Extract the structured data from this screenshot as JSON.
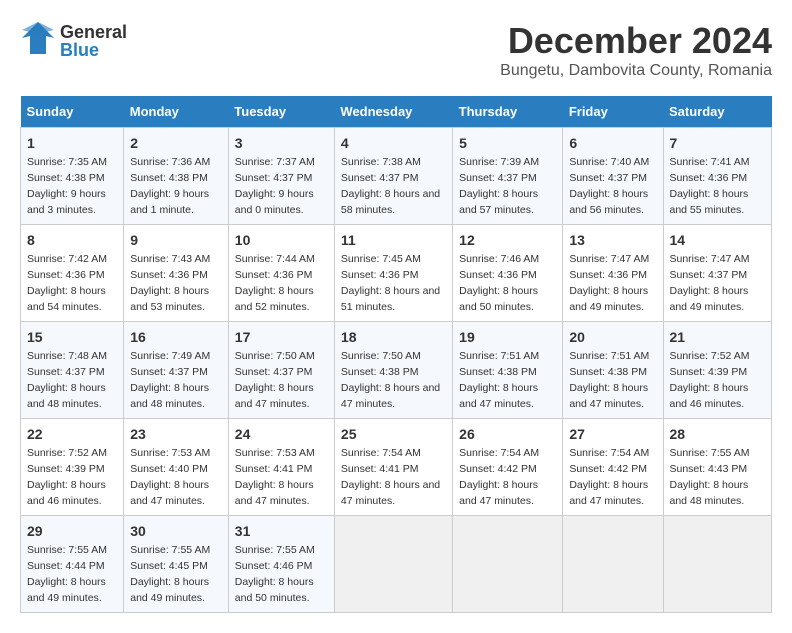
{
  "header": {
    "logo_general": "General",
    "logo_blue": "Blue",
    "month_title": "December 2024",
    "location": "Bungetu, Dambovita County, Romania"
  },
  "calendar": {
    "days_of_week": [
      "Sunday",
      "Monday",
      "Tuesday",
      "Wednesday",
      "Thursday",
      "Friday",
      "Saturday"
    ],
    "weeks": [
      [
        {
          "day": "1",
          "sunrise": "Sunrise: 7:35 AM",
          "sunset": "Sunset: 4:38 PM",
          "daylight": "Daylight: 9 hours and 3 minutes."
        },
        {
          "day": "2",
          "sunrise": "Sunrise: 7:36 AM",
          "sunset": "Sunset: 4:38 PM",
          "daylight": "Daylight: 9 hours and 1 minute."
        },
        {
          "day": "3",
          "sunrise": "Sunrise: 7:37 AM",
          "sunset": "Sunset: 4:37 PM",
          "daylight": "Daylight: 9 hours and 0 minutes."
        },
        {
          "day": "4",
          "sunrise": "Sunrise: 7:38 AM",
          "sunset": "Sunset: 4:37 PM",
          "daylight": "Daylight: 8 hours and 58 minutes."
        },
        {
          "day": "5",
          "sunrise": "Sunrise: 7:39 AM",
          "sunset": "Sunset: 4:37 PM",
          "daylight": "Daylight: 8 hours and 57 minutes."
        },
        {
          "day": "6",
          "sunrise": "Sunrise: 7:40 AM",
          "sunset": "Sunset: 4:37 PM",
          "daylight": "Daylight: 8 hours and 56 minutes."
        },
        {
          "day": "7",
          "sunrise": "Sunrise: 7:41 AM",
          "sunset": "Sunset: 4:36 PM",
          "daylight": "Daylight: 8 hours and 55 minutes."
        }
      ],
      [
        {
          "day": "8",
          "sunrise": "Sunrise: 7:42 AM",
          "sunset": "Sunset: 4:36 PM",
          "daylight": "Daylight: 8 hours and 54 minutes."
        },
        {
          "day": "9",
          "sunrise": "Sunrise: 7:43 AM",
          "sunset": "Sunset: 4:36 PM",
          "daylight": "Daylight: 8 hours and 53 minutes."
        },
        {
          "day": "10",
          "sunrise": "Sunrise: 7:44 AM",
          "sunset": "Sunset: 4:36 PM",
          "daylight": "Daylight: 8 hours and 52 minutes."
        },
        {
          "day": "11",
          "sunrise": "Sunrise: 7:45 AM",
          "sunset": "Sunset: 4:36 PM",
          "daylight": "Daylight: 8 hours and 51 minutes."
        },
        {
          "day": "12",
          "sunrise": "Sunrise: 7:46 AM",
          "sunset": "Sunset: 4:36 PM",
          "daylight": "Daylight: 8 hours and 50 minutes."
        },
        {
          "day": "13",
          "sunrise": "Sunrise: 7:47 AM",
          "sunset": "Sunset: 4:36 PM",
          "daylight": "Daylight: 8 hours and 49 minutes."
        },
        {
          "day": "14",
          "sunrise": "Sunrise: 7:47 AM",
          "sunset": "Sunset: 4:37 PM",
          "daylight": "Daylight: 8 hours and 49 minutes."
        }
      ],
      [
        {
          "day": "15",
          "sunrise": "Sunrise: 7:48 AM",
          "sunset": "Sunset: 4:37 PM",
          "daylight": "Daylight: 8 hours and 48 minutes."
        },
        {
          "day": "16",
          "sunrise": "Sunrise: 7:49 AM",
          "sunset": "Sunset: 4:37 PM",
          "daylight": "Daylight: 8 hours and 48 minutes."
        },
        {
          "day": "17",
          "sunrise": "Sunrise: 7:50 AM",
          "sunset": "Sunset: 4:37 PM",
          "daylight": "Daylight: 8 hours and 47 minutes."
        },
        {
          "day": "18",
          "sunrise": "Sunrise: 7:50 AM",
          "sunset": "Sunset: 4:38 PM",
          "daylight": "Daylight: 8 hours and 47 minutes."
        },
        {
          "day": "19",
          "sunrise": "Sunrise: 7:51 AM",
          "sunset": "Sunset: 4:38 PM",
          "daylight": "Daylight: 8 hours and 47 minutes."
        },
        {
          "day": "20",
          "sunrise": "Sunrise: 7:51 AM",
          "sunset": "Sunset: 4:38 PM",
          "daylight": "Daylight: 8 hours and 47 minutes."
        },
        {
          "day": "21",
          "sunrise": "Sunrise: 7:52 AM",
          "sunset": "Sunset: 4:39 PM",
          "daylight": "Daylight: 8 hours and 46 minutes."
        }
      ],
      [
        {
          "day": "22",
          "sunrise": "Sunrise: 7:52 AM",
          "sunset": "Sunset: 4:39 PM",
          "daylight": "Daylight: 8 hours and 46 minutes."
        },
        {
          "day": "23",
          "sunrise": "Sunrise: 7:53 AM",
          "sunset": "Sunset: 4:40 PM",
          "daylight": "Daylight: 8 hours and 47 minutes."
        },
        {
          "day": "24",
          "sunrise": "Sunrise: 7:53 AM",
          "sunset": "Sunset: 4:41 PM",
          "daylight": "Daylight: 8 hours and 47 minutes."
        },
        {
          "day": "25",
          "sunrise": "Sunrise: 7:54 AM",
          "sunset": "Sunset: 4:41 PM",
          "daylight": "Daylight: 8 hours and 47 minutes."
        },
        {
          "day": "26",
          "sunrise": "Sunrise: 7:54 AM",
          "sunset": "Sunset: 4:42 PM",
          "daylight": "Daylight: 8 hours and 47 minutes."
        },
        {
          "day": "27",
          "sunrise": "Sunrise: 7:54 AM",
          "sunset": "Sunset: 4:42 PM",
          "daylight": "Daylight: 8 hours and 47 minutes."
        },
        {
          "day": "28",
          "sunrise": "Sunrise: 7:55 AM",
          "sunset": "Sunset: 4:43 PM",
          "daylight": "Daylight: 8 hours and 48 minutes."
        }
      ],
      [
        {
          "day": "29",
          "sunrise": "Sunrise: 7:55 AM",
          "sunset": "Sunset: 4:44 PM",
          "daylight": "Daylight: 8 hours and 49 minutes."
        },
        {
          "day": "30",
          "sunrise": "Sunrise: 7:55 AM",
          "sunset": "Sunset: 4:45 PM",
          "daylight": "Daylight: 8 hours and 49 minutes."
        },
        {
          "day": "31",
          "sunrise": "Sunrise: 7:55 AM",
          "sunset": "Sunset: 4:46 PM",
          "daylight": "Daylight: 8 hours and 50 minutes."
        },
        null,
        null,
        null,
        null
      ]
    ]
  }
}
